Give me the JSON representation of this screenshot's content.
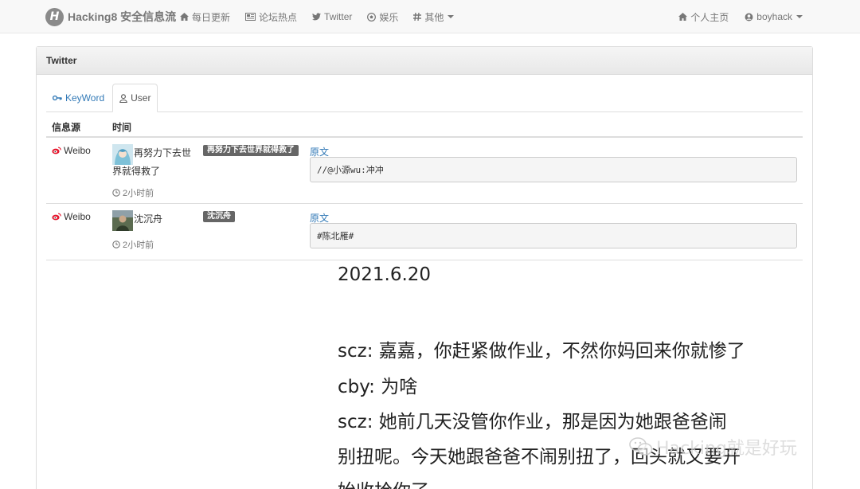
{
  "navbar": {
    "brand_logo": "H",
    "brand": "Hacking8 安全信息流",
    "items": [
      {
        "label": "每日更新",
        "icon": "home-icon"
      },
      {
        "label": "论坛热点",
        "icon": "newspaper-icon"
      },
      {
        "label": "Twitter",
        "icon": "twitter-icon"
      },
      {
        "label": "娱乐",
        "icon": "soccer-ball-icon"
      },
      {
        "label": "其他",
        "icon": "hashtag-icon"
      }
    ],
    "right_items": [
      {
        "label": "个人主页",
        "icon": "home-icon"
      },
      {
        "label": "boyhack",
        "icon": "user-icon"
      }
    ]
  },
  "panel": {
    "title": "Twitter",
    "tabs": [
      {
        "label": "KeyWord",
        "icon": "key-icon",
        "active": false
      },
      {
        "label": "User",
        "icon": "user-icon",
        "active": true
      }
    ],
    "columns": [
      "信息源",
      "时间"
    ],
    "rows": [
      {
        "source": "Weibo",
        "user_line1": "再努力下去世",
        "user_line2": "界就得救了",
        "tag": "再努力下去世界就得救了",
        "time": "2小时前",
        "link": "原文",
        "content": "//@小源wu:冲冲"
      },
      {
        "source": "Weibo",
        "user_line1": "沈沉舟",
        "user_line2": "",
        "tag": "沈沉舟",
        "time": "2小时前",
        "link": "原文",
        "content": "#陈北雁#"
      }
    ]
  },
  "article": {
    "lines": [
      "2021.6.20",
      "scz: 嘉嘉，你赶紧做作业，不然你妈回来你就惨了",
      "cby: 为啥",
      "scz: 她前几天没管你作业，那是因为她跟爸爸闹",
      "别扭呢。今天她跟爸爸不闹别扭了，回头就又要开",
      "始收拾你了"
    ]
  },
  "watermark": "Hacking就是好玩",
  "colors": {
    "link": "#337ab7",
    "weibo": "#e6162d",
    "label_bg": "#666666",
    "navbar_bg": "#f8f8f8"
  }
}
